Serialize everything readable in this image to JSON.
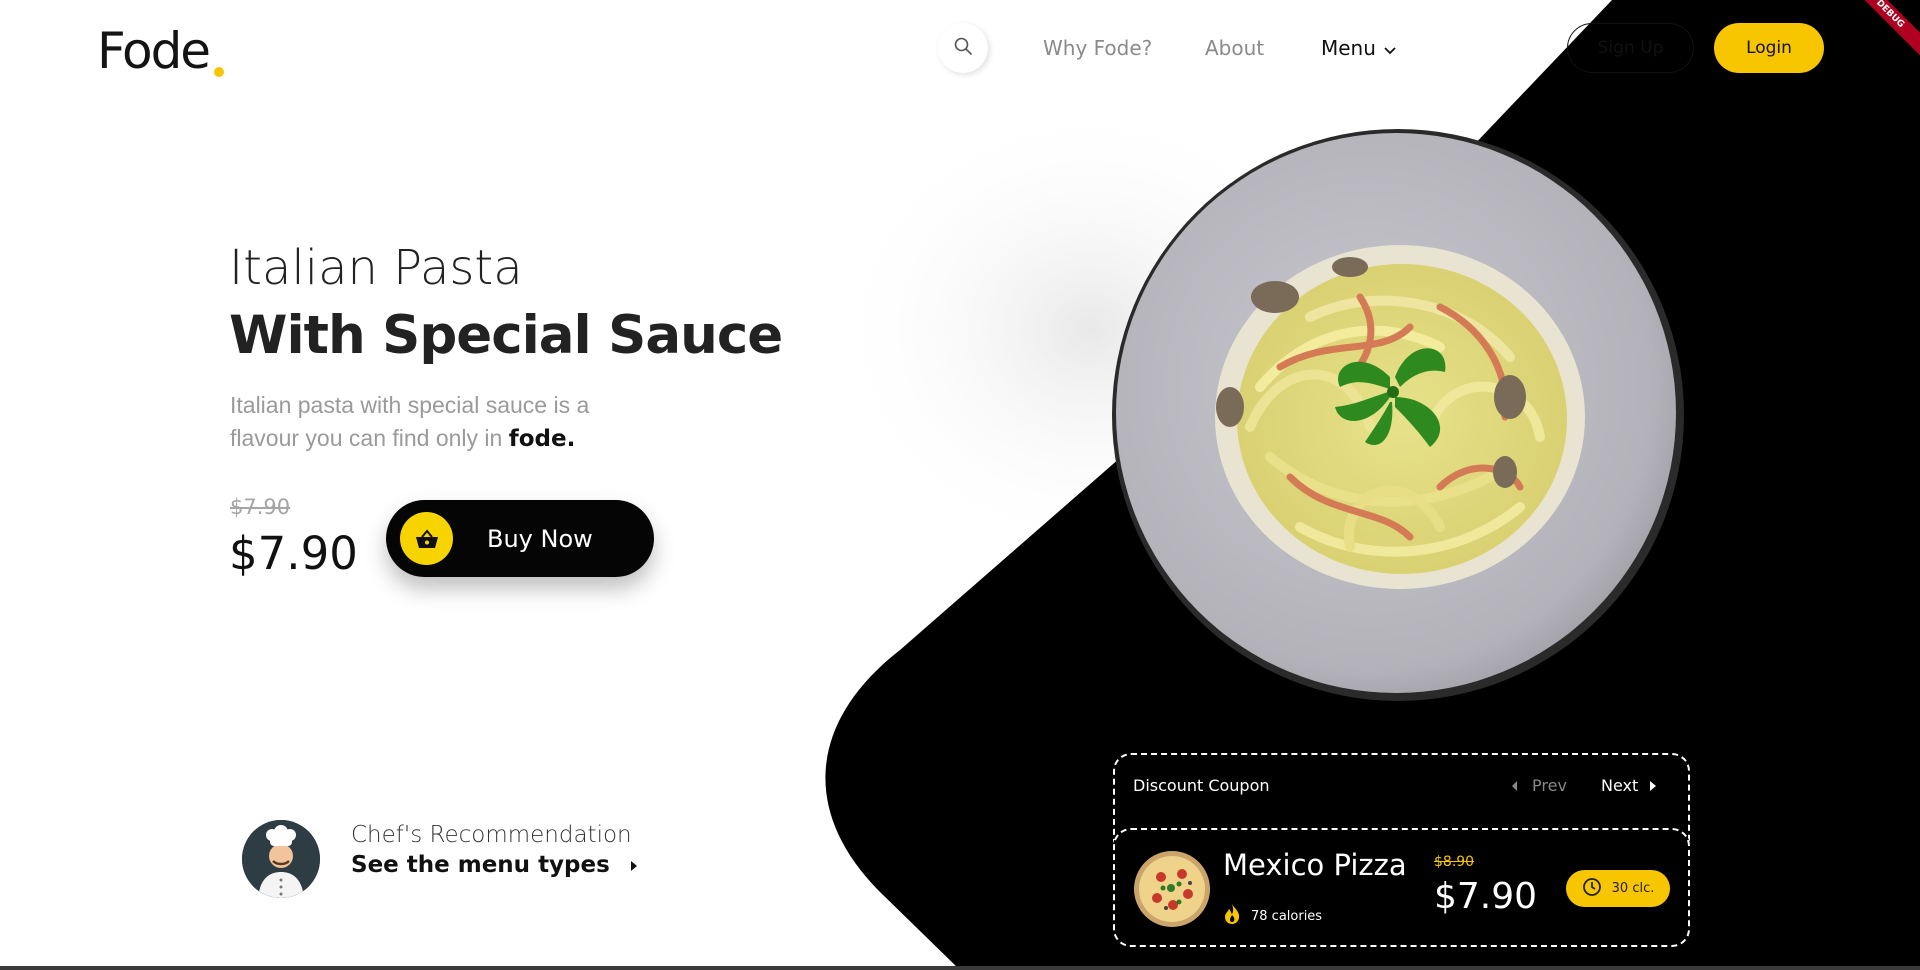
{
  "header": {
    "logo": "Fode",
    "nav": {
      "why": "Why Fode?",
      "about": "About",
      "menu": "Menu"
    },
    "signup_label": "Sign Up",
    "login_label": "Login",
    "debug_label": "DEBUG"
  },
  "hero": {
    "title_line1": "Italian Pasta",
    "title_line2": "With Special Sauce",
    "description": "Italian pasta with special sauce is a flavour you can find only in",
    "description_brand": "fode.",
    "old_price": "$7.90",
    "price": "$7.90",
    "buy_label": "Buy Now"
  },
  "chef": {
    "title": "Chef's Recommendation",
    "link_label": "See the menu types"
  },
  "coupon": {
    "title": "Discount Coupon",
    "prev_label": "Prev",
    "next_label": "Next",
    "item": {
      "name": "Mexico Pizza",
      "calories": "78 calories",
      "old_price": "$8.90",
      "price": "$7.90",
      "time": "30 clc."
    }
  },
  "colors": {
    "accent": "#f7c600",
    "dark": "#000000",
    "text_muted": "#9a9a9a"
  },
  "icons": [
    "search-icon",
    "chevron-down-icon",
    "basket-icon",
    "chevron-right-icon",
    "caret-left-icon",
    "caret-right-icon",
    "flame-icon",
    "clock-icon"
  ]
}
